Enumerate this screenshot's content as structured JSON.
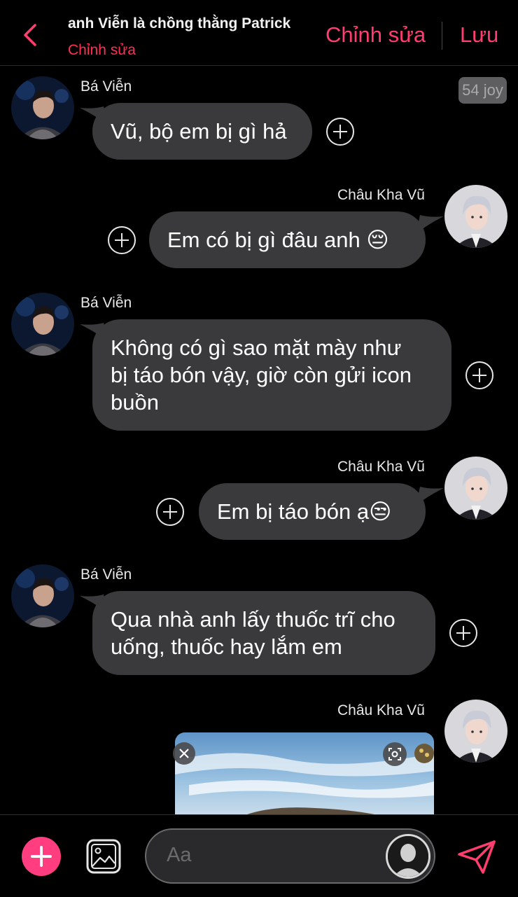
{
  "header": {
    "title": "anh Viễn là chồng thằng Patrick",
    "subtitle": "Chỉnh sửa",
    "edit_label": "Chỉnh sửa",
    "save_label": "Lưu"
  },
  "messages": [
    {
      "sender": "Bá Viễn",
      "side": "left",
      "text": "Vũ, bộ em bị gì hả"
    },
    {
      "sender": "Châu Kha Vũ",
      "side": "right",
      "text": "Em có bị gì đâu anh 😔"
    },
    {
      "sender": "Bá Viễn",
      "side": "left",
      "lines": [
        "Không có gì sao mặt mày như",
        "bị táo bón vậy, giờ còn gửi icon",
        "buồn"
      ]
    },
    {
      "sender": "Châu Kha Vũ",
      "side": "right",
      "text": "Em bị táo bón ạ😒"
    },
    {
      "sender": "Bá Viễn",
      "side": "left",
      "lines": [
        "Qua nhà anh lấy thuốc trĩ cho",
        "uống, thuốc hay lắm em"
      ]
    },
    {
      "sender": "Châu Kha Vũ",
      "side": "right",
      "attachment": "image"
    }
  ],
  "badge": {
    "count_label": "54 joy"
  },
  "input": {
    "placeholder": "Aa"
  },
  "colors": {
    "accent": "#ff3d6e",
    "bubble": "#3a3a3c",
    "background": "#000000"
  },
  "icons": [
    "back-chevron-icon",
    "add-reaction-icon",
    "plus-icon",
    "gallery-icon",
    "send-icon",
    "close-icon",
    "scan-icon",
    "person-icon"
  ]
}
